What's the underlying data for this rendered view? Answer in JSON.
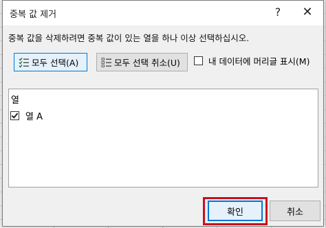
{
  "dialog": {
    "title": "중복 값 제거",
    "help_label": "?",
    "close_label": "✕"
  },
  "description": "중복 값을 삭제하려면 중복 값이 있는 열을 하나 이상 선택하십시오.",
  "buttons": {
    "select_all": "모두 선택(A)",
    "deselect_all": "모두 선택 취소(U)",
    "ok": "확인",
    "cancel": "취소"
  },
  "header_option": {
    "label": "내 데이터에 머리글 표시(M)",
    "checked": false
  },
  "columns": {
    "header": "열",
    "items": [
      {
        "label": "열 A",
        "checked": true
      }
    ]
  },
  "icons": {
    "select_all": "checklist-icon",
    "deselect_all": "unchecked-list-icon"
  },
  "colors": {
    "accent": "#0078d7",
    "highlight": "#c8101d"
  }
}
